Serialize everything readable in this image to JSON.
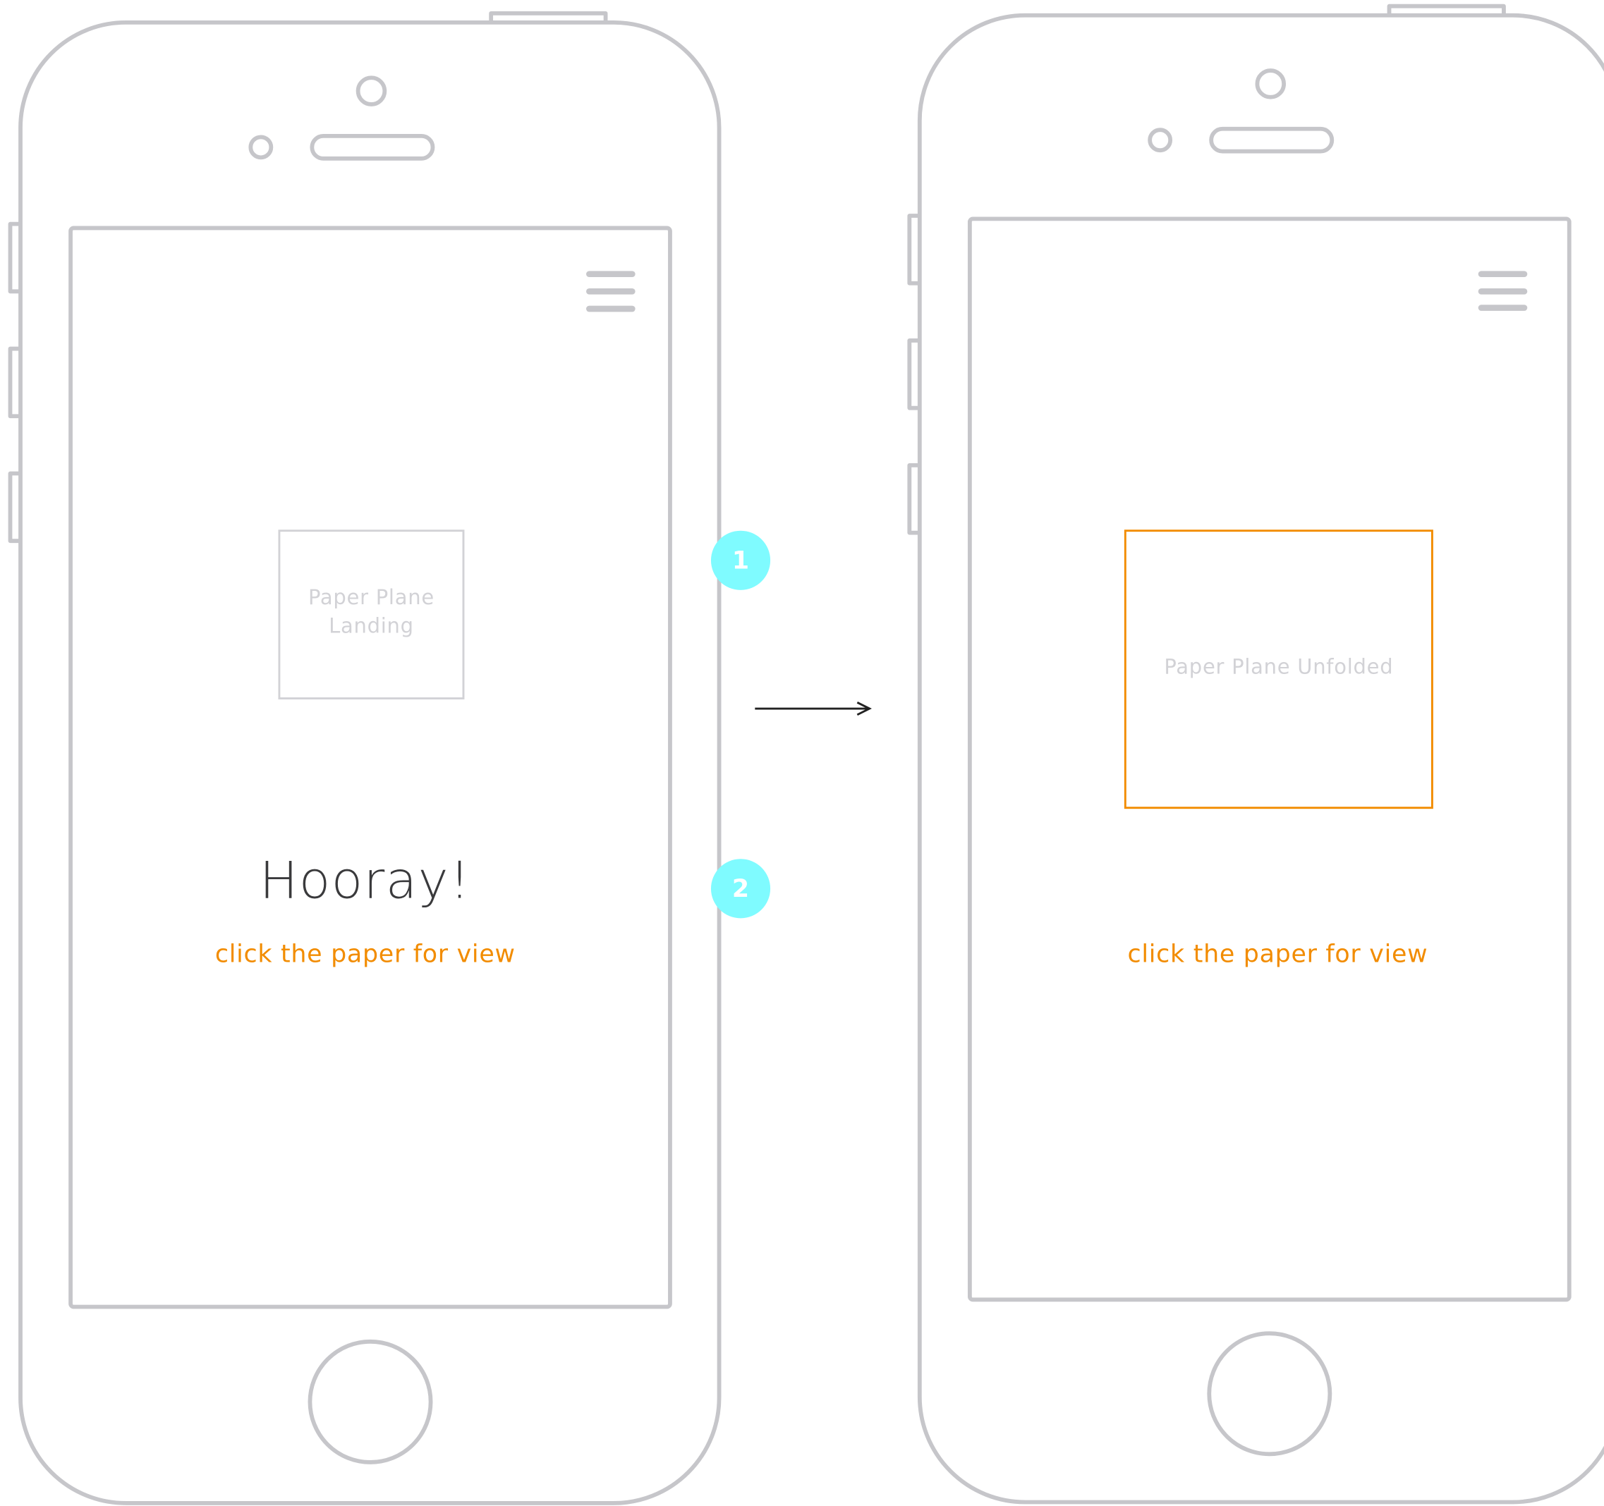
{
  "colors": {
    "outline": "#c6c6ca",
    "accent": "#f28c00",
    "badge": "#7ffbff",
    "placeholder_text": "#d2d2d6",
    "heading": "#3a3a3c"
  },
  "screen_before": {
    "menu_icon": "hamburger-menu-icon",
    "placeholder_line1": "Paper Plane",
    "placeholder_line2": "Landing",
    "heading": "Hooray!",
    "cta": "click the paper for view"
  },
  "screen_after": {
    "menu_icon": "hamburger-menu-icon",
    "placeholder": "Paper Plane Unfolded",
    "cta": "click the paper for view"
  },
  "annotations": [
    {
      "label": "1"
    },
    {
      "label": "2"
    }
  ],
  "transition": {
    "icon": "right-arrow-icon"
  }
}
